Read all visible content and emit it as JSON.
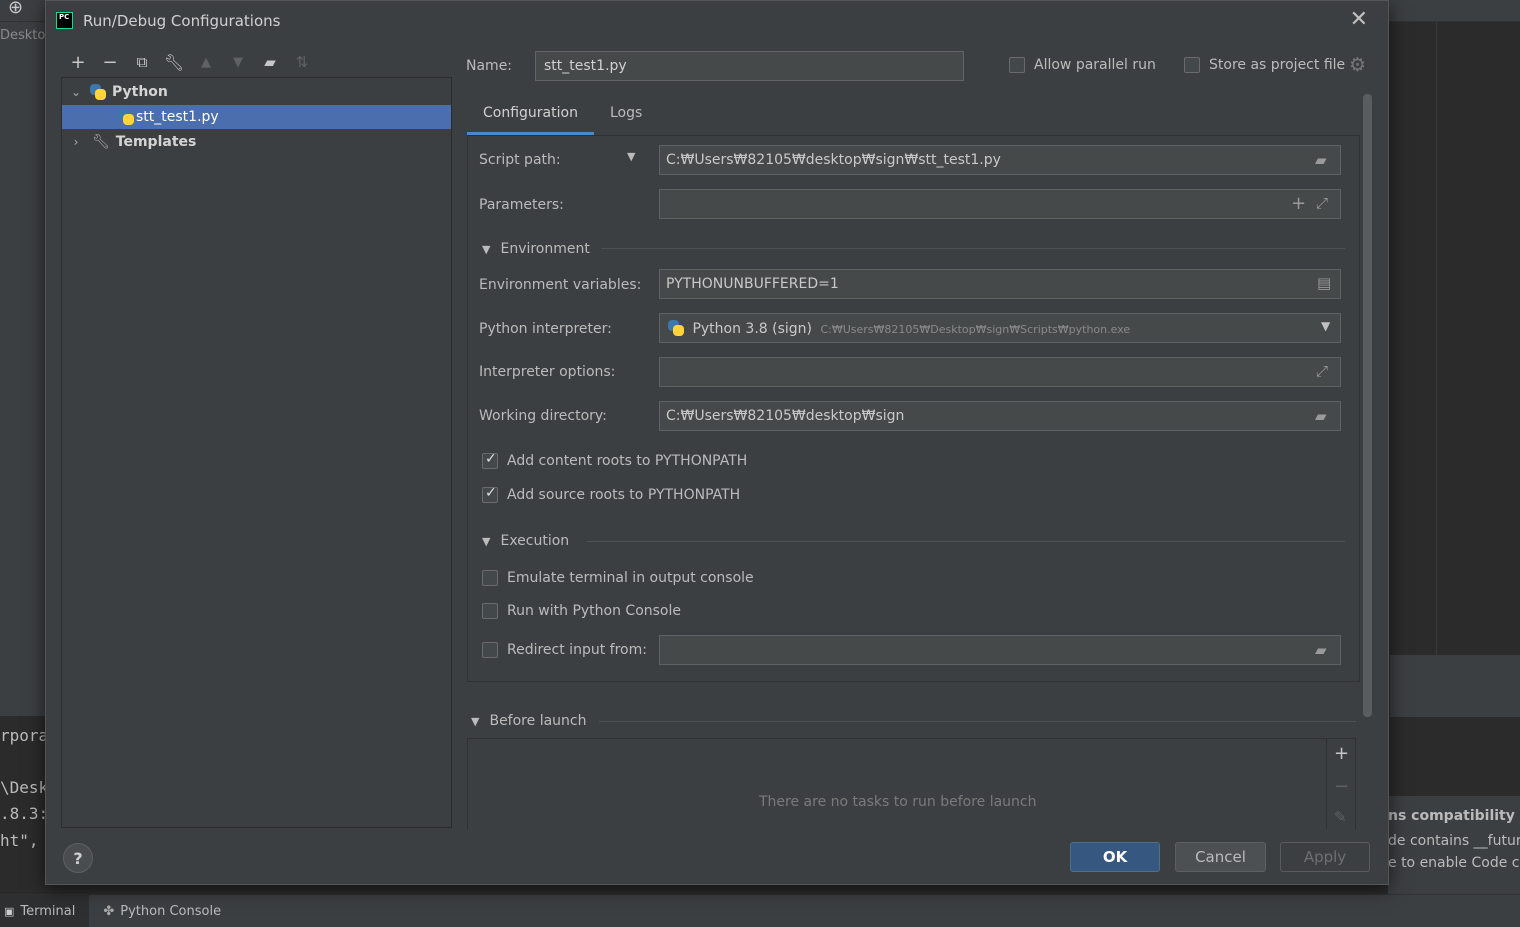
{
  "background": {
    "left_partial_text": "Deskto",
    "terminal_lines": [
      "rpora",
      "\\Desk",
      ".8.3:",
      "ht\","
    ],
    "notification": {
      "title_partial": "ns compatibility",
      "line1_partial": "de contains __futur",
      "line2_partial": "e to enable Code c"
    },
    "bottom_tabs": [
      {
        "label": "Terminal",
        "icon": "terminal-icon"
      },
      {
        "label": "Python Console",
        "icon": "python-icon"
      }
    ]
  },
  "dialog": {
    "title": "Run/Debug Configurations",
    "toolbar": [
      "add",
      "remove",
      "copy",
      "edit-defaults",
      "move-up",
      "move-down",
      "new-folder",
      "sort"
    ],
    "tree": {
      "python_group": "Python",
      "selected_config": "stt_test1.py",
      "templates": "Templates"
    },
    "name_label": "Name:",
    "name_value": "stt_test1.py",
    "allow_parallel_label": "Allow parallel run",
    "allow_parallel_checked": false,
    "store_project_label": "Store as project file",
    "store_project_checked": false,
    "tabs": [
      {
        "label": "Configuration",
        "active": true
      },
      {
        "label": "Logs",
        "active": false
      }
    ],
    "config": {
      "script_path_label": "Script path:",
      "script_path_value": "C:₩Users₩82105₩desktop₩sign₩stt_test1.py",
      "parameters_label": "Parameters:",
      "parameters_value": "",
      "environment_section": "Environment",
      "env_vars_label": "Environment variables:",
      "env_vars_value": "PYTHONUNBUFFERED=1",
      "interpreter_label": "Python interpreter:",
      "interpreter_name": "Python 3.8 (sign)",
      "interpreter_path": "C:₩Users₩82105₩Desktop₩sign₩Scripts₩python.exe",
      "interp_options_label": "Interpreter options:",
      "interp_options_value": "",
      "working_dir_label": "Working directory:",
      "working_dir_value": "C:₩Users₩82105₩desktop₩sign",
      "content_roots_label": "Add content roots to PYTHONPATH",
      "content_roots_checked": true,
      "source_roots_label": "Add source roots to PYTHONPATH",
      "source_roots_checked": true,
      "execution_section": "Execution",
      "emulate_terminal_label": "Emulate terminal in output console",
      "emulate_terminal_checked": false,
      "python_console_label": "Run with Python Console",
      "python_console_checked": false,
      "redirect_input_label": "Redirect input from:",
      "redirect_input_checked": false,
      "redirect_input_value": ""
    },
    "before_launch": {
      "section": "Before launch",
      "empty_text": "There are no tasks to run before launch"
    },
    "buttons": {
      "ok": "OK",
      "cancel": "Cancel",
      "apply": "Apply"
    },
    "help_label": "?"
  },
  "colors": {
    "dialog_bg": "#3c3f41",
    "selection": "#4b6eaf",
    "ok_button": "#365880",
    "tab_underline": "#4a88c7",
    "field_bg": "#45494a"
  }
}
